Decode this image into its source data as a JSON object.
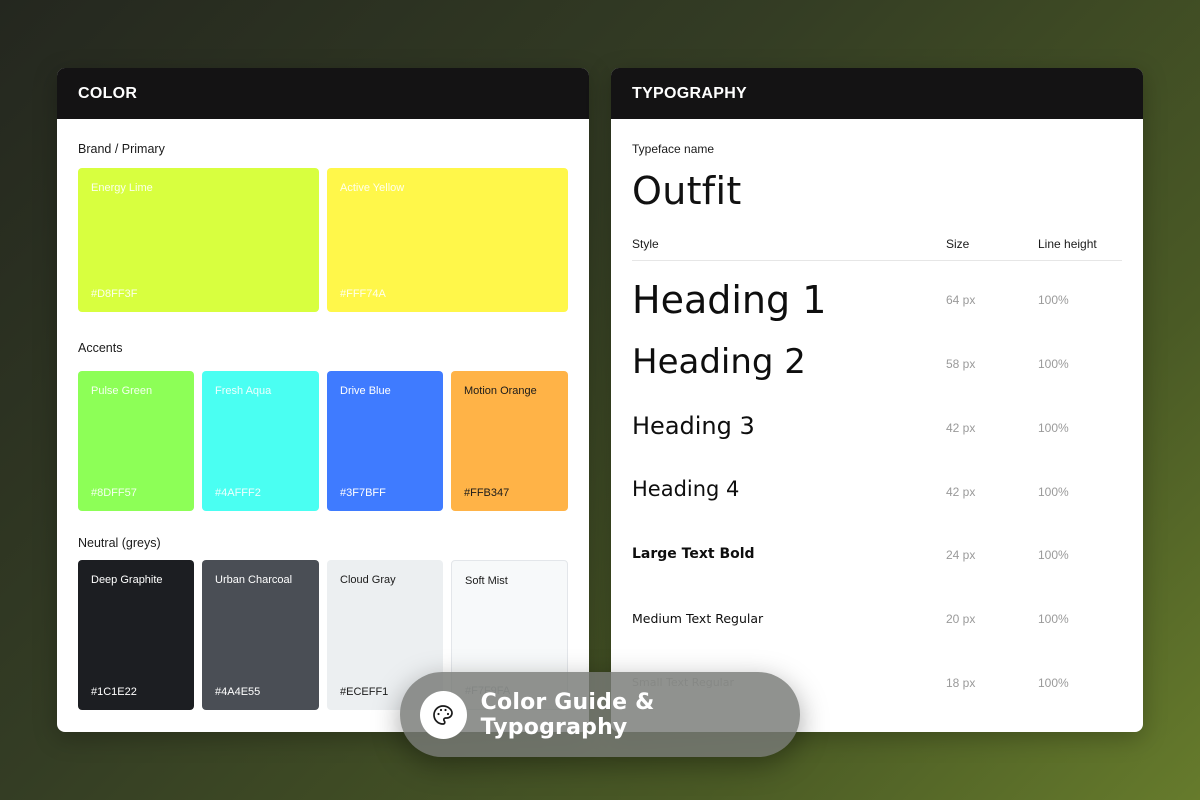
{
  "color_panel": {
    "title": "COLOR",
    "brand": {
      "label": "Brand / Primary",
      "swatches": [
        {
          "name": "Energy Lime",
          "hex": "#D8FF3F",
          "color": "#D8FF3F"
        },
        {
          "name": "Active Yellow",
          "hex": "#FFF74A",
          "color": "#FFF74A"
        }
      ]
    },
    "accents": {
      "label": "Accents",
      "swatches": [
        {
          "name": "Pulse Green",
          "hex": "#8DFF57",
          "color": "#8DFF57"
        },
        {
          "name": "Fresh Aqua",
          "hex": "#4AFFF2",
          "color": "#4AFFF2"
        },
        {
          "name": "Drive Blue",
          "hex": "#3F7BFF",
          "color": "#3F7BFF"
        },
        {
          "name": "Motion Orange",
          "hex": "#FFB347",
          "color": "#FFB347"
        }
      ]
    },
    "neutral": {
      "label": "Neutral (greys)",
      "swatches": [
        {
          "name": "Deep Graphite",
          "hex": "#1C1E22",
          "color": "#1C1E22"
        },
        {
          "name": "Urban Charcoal",
          "hex": "#4A4E55",
          "color": "#4A4E55"
        },
        {
          "name": "Cloud Gray",
          "hex": "#ECEFF1",
          "color": "#ECEFF1"
        },
        {
          "name": "Soft Mist",
          "hex": "#F7F9FA",
          "color": "#F7F9FA"
        }
      ]
    }
  },
  "type_panel": {
    "title": "TYPOGRAPHY",
    "typeface_label": "Typeface name",
    "typeface": "Outfit",
    "columns": {
      "style": "Style",
      "size": "Size",
      "line_height": "Line height"
    },
    "rows": [
      {
        "style": "Heading 1",
        "size": "64 px",
        "line_height": "100%"
      },
      {
        "style": "Heading 2",
        "size": "58 px",
        "line_height": "100%"
      },
      {
        "style": "Heading 3",
        "size": "42 px",
        "line_height": "100%"
      },
      {
        "style": "Heading 4",
        "size": "42 px",
        "line_height": "100%"
      },
      {
        "style": "Large Text Bold",
        "size": "24 px",
        "line_height": "100%"
      },
      {
        "style": "Medium Text Regular",
        "size": "20 px",
        "line_height": "100%"
      },
      {
        "style": "Small Text Regular",
        "size": "18 px",
        "line_height": "100%"
      }
    ]
  },
  "badge": {
    "icon": "palette-icon",
    "label": "Color Guide & Typography"
  }
}
